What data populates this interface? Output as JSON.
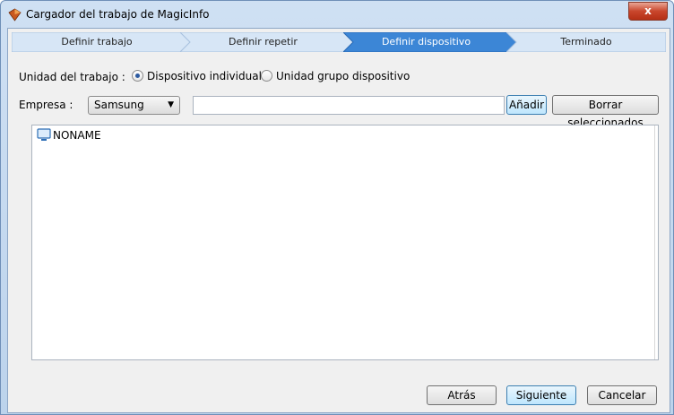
{
  "window": {
    "title": "Cargador del trabajo de MagicInfo",
    "close_label": "x"
  },
  "steps": [
    {
      "label": "Definir trabajo",
      "active": false
    },
    {
      "label": "Definir repetir",
      "active": false
    },
    {
      "label": "Definir dispositivo",
      "active": true
    },
    {
      "label": "Terminado",
      "active": false
    }
  ],
  "form": {
    "unit_label": "Unidad del trabajo :",
    "options": [
      {
        "label": "Dispositivo individual",
        "selected": true
      },
      {
        "label": "Unidad grupo dispositivo",
        "selected": false
      }
    ],
    "company_label": "Empresa :",
    "company_value": "Samsung",
    "search_value": "",
    "add_label": "Añadir",
    "clear_label": "Borrar seleccionados"
  },
  "device_list": [
    {
      "name": "NONAME",
      "icon": "monitor-icon"
    }
  ],
  "footer": {
    "back_label": "Atrás",
    "next_label": "Siguiente",
    "cancel_label": "Cancelar"
  },
  "colors": {
    "active_step": "#3c86d6",
    "inactive_step": "#d7e6f6",
    "accent": "#2c5aa0"
  }
}
